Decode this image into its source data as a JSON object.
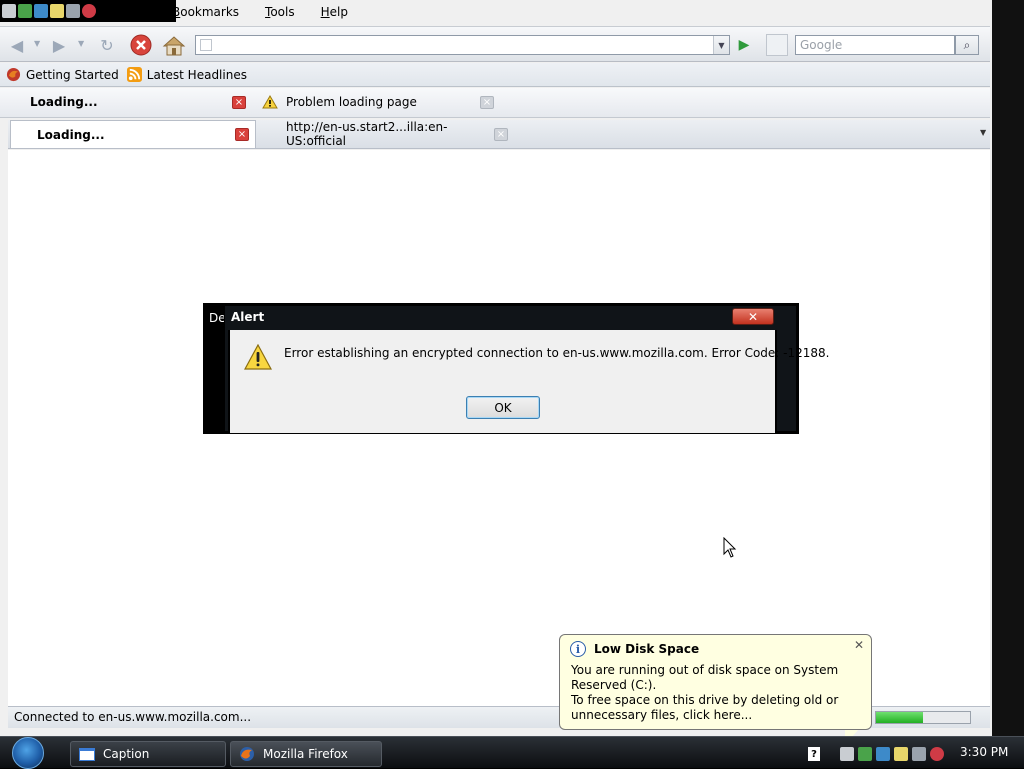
{
  "menu": [
    "Bookmarks",
    "Tools",
    "Help"
  ],
  "navbar": {
    "url_value": "",
    "search_placeholder": "Google"
  },
  "bookmarks": [
    {
      "label": "Getting Started",
      "icon": "firefox-icon"
    },
    {
      "label": "Latest Headlines",
      "icon": "rss-icon"
    }
  ],
  "tabs_row1": [
    {
      "label": "Loading...",
      "close": "×"
    },
    {
      "label": "Problem loading page",
      "close": "×"
    }
  ],
  "tabs_row2": [
    {
      "label": "Loading...",
      "close": "×"
    },
    {
      "label": "http://en-us.start2...illa:en-US:official",
      "close": "×"
    }
  ],
  "status": {
    "text": "Connected to en-us.www.mozilla.com...",
    "progress": 0.5
  },
  "alert": {
    "back_title": "De",
    "title": "Alert",
    "close": "✕",
    "message": "Error establishing an encrypted connection to en-us.www.mozilla.com. Error Code: -12188.",
    "ok_label": "OK"
  },
  "balloon": {
    "title": "Low Disk Space",
    "close": "✕",
    "line1": "You are running out of disk space on System Reserved (C:).",
    "line2": "To free space on this drive by deleting old or unnecessary files, click here..."
  },
  "taskbar": {
    "buttons": [
      {
        "label": "Caption",
        "icon": "window-icon"
      },
      {
        "label": "Mozilla Firefox",
        "icon": "firefox-icon"
      }
    ],
    "clock": "3:30 PM"
  },
  "colors": {
    "close_red": "#d9413c",
    "go_green": "#2f9a3c",
    "balloon_bg": "#ffffe1",
    "progress_green": "#22b022"
  }
}
